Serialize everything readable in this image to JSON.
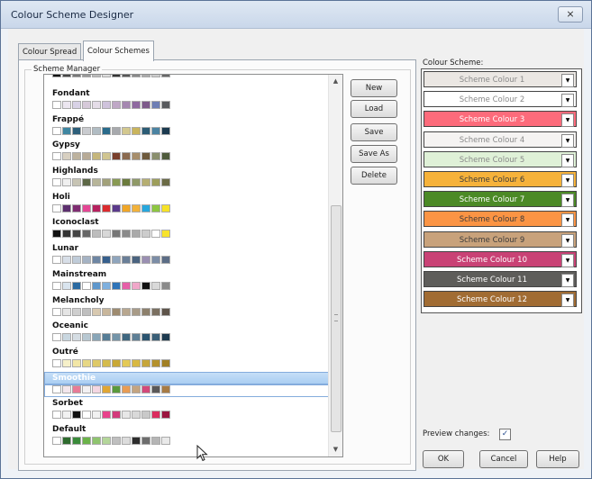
{
  "window": {
    "title": "Colour Scheme Designer",
    "close_glyph": "⨯"
  },
  "tabs": [
    {
      "label": "Colour Spread"
    },
    {
      "label": "Colour Schemes"
    }
  ],
  "scheme_manager": {
    "label": "Scheme Manager",
    "items": [
      {
        "name": "",
        "swatches": [
          "#111111",
          "#444444",
          "#777777",
          "#999999",
          "#bbbbbb",
          "#dddddd",
          "#333333",
          "#555555",
          "#888888",
          "#aaaaaa",
          "#cccccc",
          "#666666"
        ]
      },
      {
        "name": "Fondant",
        "swatches": [
          "#ffffff",
          "#ece6f0",
          "#d8d2e6",
          "#d6c9d9",
          "#e5dde8",
          "#cfc3dc",
          "#bfa8c6",
          "#a487b0",
          "#8f6aa0",
          "#7d5a8a",
          "#6e7eb4",
          "#585a5d"
        ]
      },
      {
        "name": "Frappé",
        "swatches": [
          "#ffffff",
          "#3f86a1",
          "#2d5f7a",
          "#c9cbcf",
          "#b1bcc3",
          "#2a6b8b",
          "#a7a9ad",
          "#d3c88f",
          "#c9b45d",
          "#2c5c75",
          "#4b83a2",
          "#1b3a4f"
        ]
      },
      {
        "name": "Gypsy",
        "swatches": [
          "#ffffff",
          "#d8d0c1",
          "#bdb29e",
          "#b7aa96",
          "#c5b67c",
          "#d0c591",
          "#7a3f2c",
          "#8b6a4f",
          "#a78e6b",
          "#6e5a3c",
          "#8a8f6d",
          "#4f5b3c"
        ]
      },
      {
        "name": "Highlands",
        "swatches": [
          "#ffffff",
          "#f0f0f0",
          "#c7c4b4",
          "#5d6846",
          "#b7b599",
          "#a2a17a",
          "#899a54",
          "#6b7b3d",
          "#8f9967",
          "#b5ae72",
          "#9d9e5b",
          "#6b6b45"
        ]
      },
      {
        "name": "Holi",
        "swatches": [
          "#ffffff",
          "#5c2f6e",
          "#7f2d72",
          "#e44694",
          "#b6215f",
          "#db2b2f",
          "#5b3a8b",
          "#f0a627",
          "#f2b23b",
          "#27a7dd",
          "#8dc641",
          "#f6e227"
        ]
      },
      {
        "name": "Iconoclast",
        "swatches": [
          "#111111",
          "#333333",
          "#444444",
          "#666666",
          "#bdbdbd",
          "#d8d8d8",
          "#777777",
          "#8a8a8a",
          "#aaaaaa",
          "#cccccc",
          "#ffffff",
          "#f7e32c"
        ]
      },
      {
        "name": "Lunar",
        "swatches": [
          "#ffffff",
          "#d8dfe8",
          "#c0ccd9",
          "#a5b3c4",
          "#6e86a3",
          "#37608d",
          "#8fa5bd",
          "#6a7f98",
          "#4b6480",
          "#9a8fb2",
          "#7c8da6",
          "#5c6d86"
        ]
      },
      {
        "name": "Mainstream",
        "swatches": [
          "#ffffff",
          "#d9e4ee",
          "#2b6aa1",
          "#ffffff",
          "#5e97cc",
          "#7fb0de",
          "#2f74b8",
          "#e65fa7",
          "#f0a7c9",
          "#111111",
          "#d9d9d9",
          "#8a8a8a"
        ]
      },
      {
        "name": "Melancholy",
        "swatches": [
          "#ffffff",
          "#e5e5e5",
          "#cfcfcf",
          "#bfbfbf",
          "#d8c9b0",
          "#c8b69b",
          "#9e8b70",
          "#b8a78f",
          "#a89b87",
          "#8d806c",
          "#7a6f60",
          "#5e5449"
        ]
      },
      {
        "name": "Oceanic",
        "swatches": [
          "#ffffff",
          "#c9d7e0",
          "#d5dde3",
          "#b8c8d2",
          "#89a6b8",
          "#567d96",
          "#7494a8",
          "#3f6780",
          "#5e7f95",
          "#2b5470",
          "#3a5f77",
          "#1d3a4f"
        ]
      },
      {
        "name": "Outré",
        "swatches": [
          "#ffffff",
          "#f6f0c9",
          "#f2e6a6",
          "#e7d785",
          "#dec968",
          "#d4bb4d",
          "#c9a837",
          "#e3c956",
          "#d8b843",
          "#c6a53a",
          "#b4912d",
          "#a17f24"
        ]
      },
      {
        "name": "Smoothie",
        "selected": true,
        "swatches": [
          "#ffffff",
          "#f3e7ed",
          "#e77b97",
          "#f3f1f3",
          "#f4d7e2",
          "#e0a634",
          "#5a9a3c",
          "#e89c54",
          "#c4a481",
          "#d3497a",
          "#5a5858",
          "#a77b45"
        ]
      },
      {
        "name": "Sorbet",
        "swatches": [
          "#ffffff",
          "#f2f2f2",
          "#111111",
          "#ffffff",
          "#f1f1f1",
          "#e8438c",
          "#d33b7c",
          "#e7e7e7",
          "#d9d9d9",
          "#c9c9c9",
          "#db2d5f",
          "#9b1640"
        ]
      },
      {
        "name": "Default",
        "swatches": [
          "#ffffff",
          "#2e6b2e",
          "#3a8a3a",
          "#6bb24a",
          "#8fc46f",
          "#b4d69a",
          "#bfbfbf",
          "#dcdcdc",
          "#2d2d2d",
          "#6d6d6d",
          "#b5b5b5",
          "#e9e9e9"
        ]
      }
    ]
  },
  "buttons": {
    "new": "New",
    "load": "Load",
    "save": "Save",
    "save_as": "Save As",
    "delete": "Delete",
    "ok": "OK",
    "cancel": "Cancel",
    "help": "Help"
  },
  "colour_scheme": {
    "label": "Colour Scheme:",
    "rows": [
      {
        "label": "Scheme Colour 1",
        "bg": "#ebe7e3",
        "fg": "#8a8a8a"
      },
      {
        "label": "Scheme Colour 2",
        "bg": "#ffffff",
        "fg": "#8a8a8a"
      },
      {
        "label": "Scheme Colour 3",
        "bg": "#fd6b7b",
        "fg": "#ffffff"
      },
      {
        "label": "Scheme Colour 4",
        "bg": "#f5f3f2",
        "fg": "#8a8a8a"
      },
      {
        "label": "Scheme Colour 5",
        "bg": "#dff1d7",
        "fg": "#8a8a8a"
      },
      {
        "label": "Scheme Colour 6",
        "bg": "#f6b23a",
        "fg": "#3a3a3a"
      },
      {
        "label": "Scheme Colour 7",
        "bg": "#4c8a26",
        "fg": "#ffffff"
      },
      {
        "label": "Scheme Colour 8",
        "bg": "#fb9444",
        "fg": "#3a3a3a"
      },
      {
        "label": "Scheme Colour 9",
        "bg": "#c8a27b",
        "fg": "#3a3a3a"
      },
      {
        "label": "Scheme Colour 10",
        "bg": "#c94275",
        "fg": "#ffffff"
      },
      {
        "label": "Scheme Colour 11",
        "bg": "#5e5d5a",
        "fg": "#ffffff"
      },
      {
        "label": "Scheme Colour 12",
        "bg": "#a16c33",
        "fg": "#ffffff"
      }
    ]
  },
  "preview": {
    "label": "Preview changes:",
    "checked": true,
    "check_glyph": "✓"
  }
}
